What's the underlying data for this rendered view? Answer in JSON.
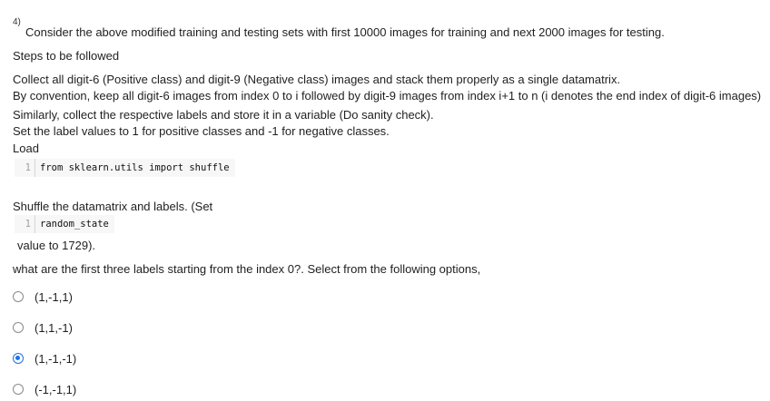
{
  "question": {
    "number": "4)",
    "text": "Consider the above modified training and testing sets with first 10000 images for training and next 2000 images for testing."
  },
  "steps_heading": "Steps to be followed",
  "instructions": [
    "Collect all digit-6 (Positive class) and digit-9 (Negative class) images and stack them properly as a single datamatrix.",
    "By convention, keep all digit-6 images from index 0 to i followed by digit-9 images from index i+1 to n (i denotes the end index of digit-6 images)",
    "Similarly, collect the respective labels and store it in a variable (Do sanity check).",
    "Set the label values to 1 for positive classes and -1 for negative classes."
  ],
  "load_label": "Load",
  "code1": {
    "line_number": "1",
    "code": "from sklearn.utils import shuffle"
  },
  "shuffle_text": "Shuffle the datamatrix and labels. (Set",
  "code2": {
    "line_number": "1",
    "code": "random_state"
  },
  "value_text": "value to 1729).",
  "prompt": "what are the first three labels starting from the index 0?. Select from the following options,",
  "options": [
    {
      "label": "(1,-1,1)",
      "selected": false
    },
    {
      "label": "(1,1,-1)",
      "selected": false
    },
    {
      "label": "(1,-1,-1)",
      "selected": true
    },
    {
      "label": "(-1,-1,1)",
      "selected": false
    }
  ],
  "colors": {
    "accent": "#1a73e8",
    "text": "#1f1f1f",
    "code_bg": "#f7f7f7"
  }
}
